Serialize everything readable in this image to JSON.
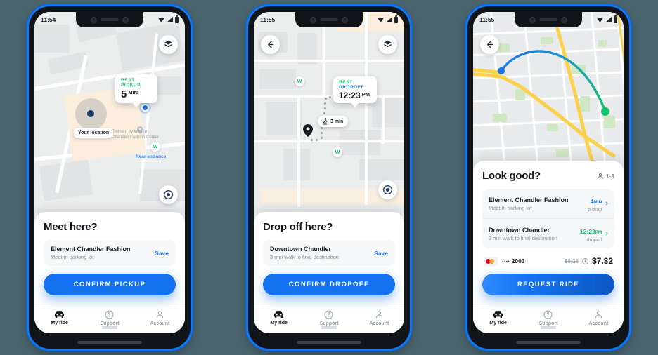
{
  "background_color": "#4b656f",
  "accent_blue": "#1a73e8",
  "accent_green": "#13c26a",
  "phones": [
    {
      "id": "pickup",
      "status_bar": {
        "time": "11:54",
        "wifi_icon": "wifi-icon",
        "signal_icon": "signal-icon",
        "battery_icon": "battery-icon"
      },
      "map": {
        "layers_button_icon": "layers-icon",
        "callout": {
          "kicker": "BEST PICKUP",
          "value": "5",
          "unit": "MIN"
        },
        "user_badge": "Your location",
        "poi_label": "Element by Westin\nChandler Fashion Center",
        "entrance_label": "Rear entrance",
        "brand_badge": "W"
      },
      "sheet": {
        "title": "Meet here?",
        "place_name": "Element Chandler Fashion",
        "place_sub": "Meet in parking lot",
        "save_label": "Save",
        "cta_label": "CONFIRM PICKUP"
      },
      "tabs": [
        {
          "label": "My ride",
          "icon": "car-icon",
          "active": true
        },
        {
          "label": "Support",
          "icon": "help-icon",
          "active": false
        },
        {
          "label": "Account",
          "icon": "person-icon",
          "active": false
        }
      ]
    },
    {
      "id": "dropoff",
      "status_bar": {
        "time": "11:55",
        "wifi_icon": "wifi-icon",
        "signal_icon": "signal-icon",
        "battery_icon": "battery-icon"
      },
      "map": {
        "back_button_icon": "arrow-left-icon",
        "layers_button_icon": "layers-icon",
        "locate_button_icon": "locate-icon",
        "callout": {
          "kicker_a": "BEST",
          "kicker_b": "DROPOFF",
          "value": "12:23",
          "unit": "PM"
        },
        "walk_badge": {
          "icon": "walk-icon",
          "label": "3 min"
        },
        "brand_badge": "W"
      },
      "sheet": {
        "title": "Drop off here?",
        "place_name": "Downtown Chandler",
        "place_sub": "3 min walk to final destination",
        "save_label": "Save",
        "cta_label": "CONFIRM DROPOFF"
      },
      "tabs": [
        {
          "label": "My ride",
          "icon": "car-icon",
          "active": true
        },
        {
          "label": "Support",
          "icon": "help-icon",
          "active": false
        },
        {
          "label": "Account",
          "icon": "person-icon",
          "active": false
        }
      ]
    },
    {
      "id": "confirm",
      "status_bar": {
        "time": "11:55",
        "wifi_icon": "wifi-icon",
        "signal_icon": "signal-icon",
        "battery_icon": "battery-icon"
      },
      "map": {
        "back_button_icon": "arrow-left-icon",
        "route_start_color": "#1a73e8",
        "route_end_color": "#13c26a"
      },
      "sheet": {
        "title": "Look good?",
        "pax_icon": "person-icon",
        "pax_label": "1-3",
        "rows": [
          {
            "name": "Element Chandler Fashion",
            "sub": "Meet in parking lot",
            "value": "4",
            "unit": "MIN",
            "type": "pickup",
            "color": "blue",
            "chevron": "chevron-right-icon"
          },
          {
            "name": "Downtown Chandler",
            "sub": "3 min walk to final destination",
            "value": "12:23",
            "unit": "PM",
            "type": "dropoff",
            "color": "green",
            "chevron": "chevron-right-icon"
          }
        ],
        "payment": {
          "card_icon": "mastercard-icon",
          "card_number": "···· 2003",
          "original_price": "$9.25",
          "info_icon": "info-icon",
          "price": "$7.32"
        },
        "cta_label": "REQUEST RIDE"
      },
      "tabs": [
        {
          "label": "My ride",
          "icon": "car-icon",
          "active": true
        },
        {
          "label": "Support",
          "icon": "help-icon",
          "active": false
        },
        {
          "label": "Account",
          "icon": "person-icon",
          "active": false
        }
      ]
    }
  ]
}
